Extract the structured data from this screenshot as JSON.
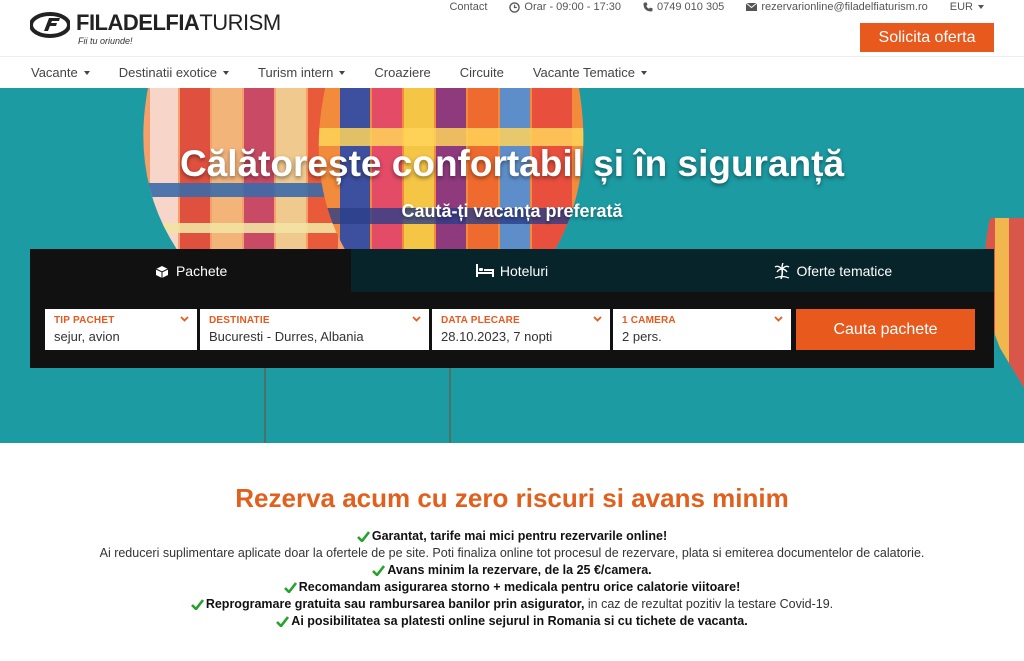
{
  "brand": {
    "name_bold": "FILADELFIA",
    "name_thin": "TURISM",
    "tagline": "Fii tu oriunde!"
  },
  "topbar": {
    "contact": "Contact",
    "hours": "Orar - 09:00 - 17:30",
    "phone": "0749 010 305",
    "email": "rezervarionline@filadelfiaturism.ro",
    "currency": "EUR"
  },
  "cta": {
    "label": "Solicita oferta"
  },
  "nav": [
    {
      "label": "Vacante",
      "dropdown": true
    },
    {
      "label": "Destinatii exotice",
      "dropdown": true
    },
    {
      "label": "Turism intern",
      "dropdown": true
    },
    {
      "label": "Croaziere",
      "dropdown": false
    },
    {
      "label": "Circuite",
      "dropdown": false
    },
    {
      "label": "Vacante Tematice",
      "dropdown": true
    }
  ],
  "hero": {
    "title": "Călătorește confortabil și în siguranță",
    "subtitle": "Caută-ți vacanța preferată"
  },
  "search": {
    "tabs": [
      {
        "label": "Pachete",
        "icon": "suitcase-icon",
        "active": true
      },
      {
        "label": "Hoteluri",
        "icon": "bed-icon",
        "active": false
      },
      {
        "label": "Oferte tematice",
        "icon": "palm-tree-icon",
        "active": false
      }
    ],
    "fields": [
      {
        "label": "TIP PACHET",
        "value": "sejur, avion"
      },
      {
        "label": "DESTINATIE",
        "value": "Bucuresti - Durres, Albania"
      },
      {
        "label": "DATA PLECARE",
        "value": "28.10.2023, 7 nopti"
      },
      {
        "label": "1 CAMERA",
        "value": "2 pers."
      }
    ],
    "button": "Cauta pachete"
  },
  "info": {
    "title": "Rezerva acum cu zero riscuri si avans minim",
    "l1": "Garantat, tarife mai mici pentru rezervarile online!",
    "l2": "Ai reduceri suplimentare aplicate doar la ofertele de pe site. Poti finaliza online tot procesul de rezervare, plata si emiterea documentelor de calatorie.",
    "l3": "Avans minim la rezervare, de la 25 €/camera.",
    "l4": "Recomandam asigurarea storno + medicala pentru orice calatorie viitoare!",
    "l5_bold": "Reprogramare gratuita sau rambursarea banilor prin asigurator,",
    "l5_rest": " in caz de rezultat pozitiv la testare Covid-19.",
    "l6": "Ai posibilitatea sa platesti online sejurul in Romania si cu tichete de vacanta."
  },
  "colors": {
    "accent": "#e8591e",
    "hero_bg": "#1c9ba3",
    "check": "#27a22d"
  }
}
